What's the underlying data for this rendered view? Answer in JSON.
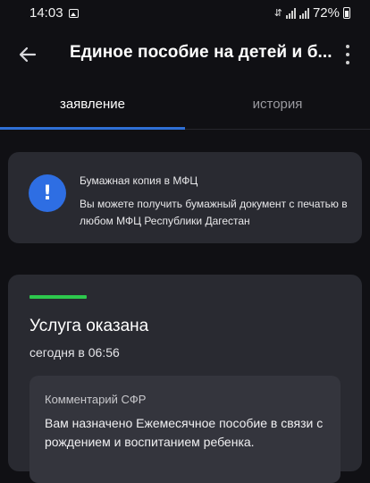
{
  "status_bar": {
    "time": "14:03",
    "battery": "72%",
    "icons": [
      "gallery-icon",
      "vibrate-icon",
      "signal-icon",
      "battery-icon"
    ]
  },
  "app_bar": {
    "title": "Единое пособие на детей и б...",
    "icons": [
      "back-arrow-icon",
      "more-vert-icon"
    ]
  },
  "tabs": [
    {
      "label": "заявление",
      "active": true
    },
    {
      "label": "история",
      "active": false
    }
  ],
  "info_card": {
    "title": "Бумажная копия в МФЦ",
    "text": "Вы можете получить бумажный документ с печатью в любом МФЦ Республики Дагестан",
    "icon": "exclamation-icon"
  },
  "status_card": {
    "title": "Услуга оказана",
    "date": "сегодня в 06:56",
    "comment": {
      "label": "Комментарий СФР",
      "text": "Вам назначено Ежемесячное пособие в связи с рождением и воспитанием ребенка."
    }
  },
  "colors": {
    "background": "#101014",
    "card": "#292a31",
    "accent": "#2f6fd6",
    "success": "#2dc84d"
  }
}
